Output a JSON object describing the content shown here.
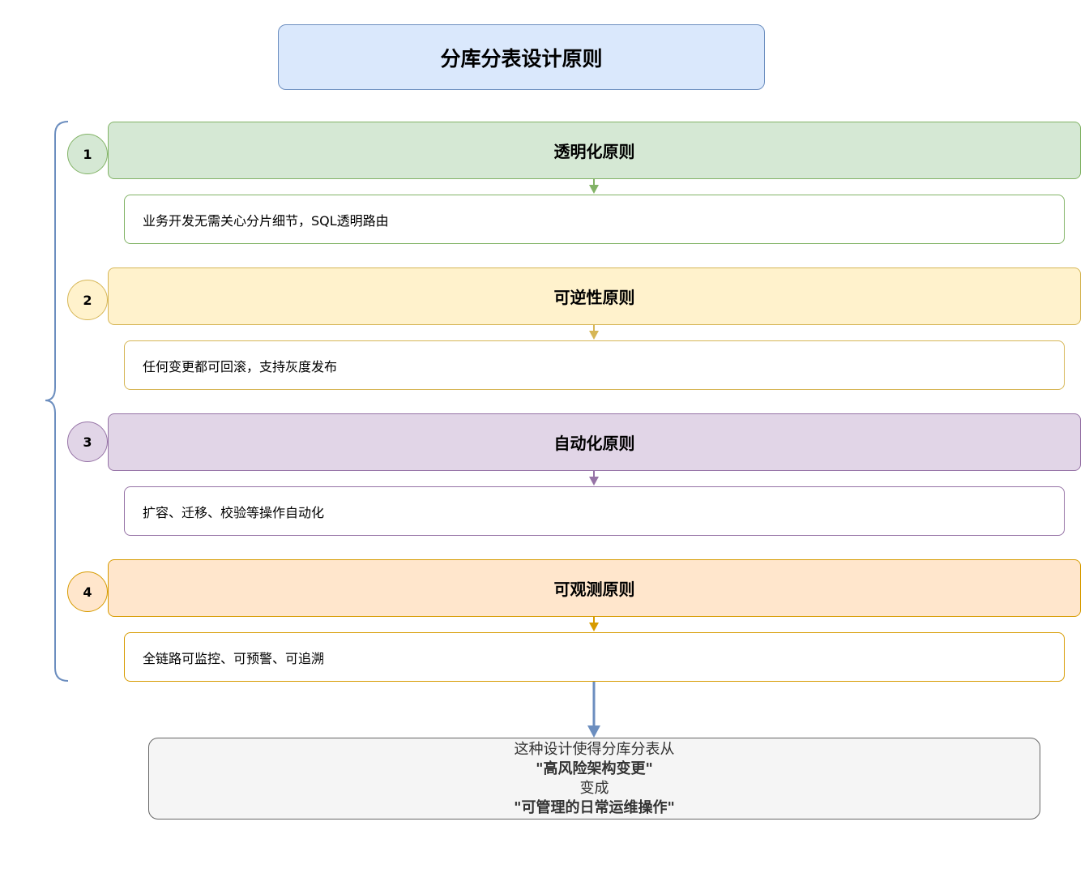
{
  "title": "分库分表设计原则",
  "principles": [
    {
      "number": "1",
      "name": "透明化原则",
      "description": "业务开发无需关心分片细节，SQL透明路由",
      "fill": "#d5e8d4",
      "stroke": "#82b366"
    },
    {
      "number": "2",
      "name": "可逆性原则",
      "description": "任何变更都可回滚，支持灰度发布",
      "fill": "#fff2cc",
      "stroke": "#d6b656"
    },
    {
      "number": "3",
      "name": "自动化原则",
      "description": "扩容、迁移、校验等操作自动化",
      "fill": "#e1d5e7",
      "stroke": "#9673a6"
    },
    {
      "number": "4",
      "name": "可观测原则",
      "description": "全链路可监控、可预警、可追溯",
      "fill": "#ffe6cc",
      "stroke": "#d79b00"
    }
  ],
  "summary": {
    "line1": "这种设计使得分库分表从",
    "line2": "\"高风险架构变更\"",
    "line3": "变成",
    "line4": "\"可管理的日常运维操作\""
  },
  "colors": {
    "title_fill": "#dae8fc",
    "title_stroke": "#6c8ebf",
    "brace": "#6c8ebf",
    "summary_fill": "#f5f5f5",
    "summary_stroke": "#666666"
  }
}
